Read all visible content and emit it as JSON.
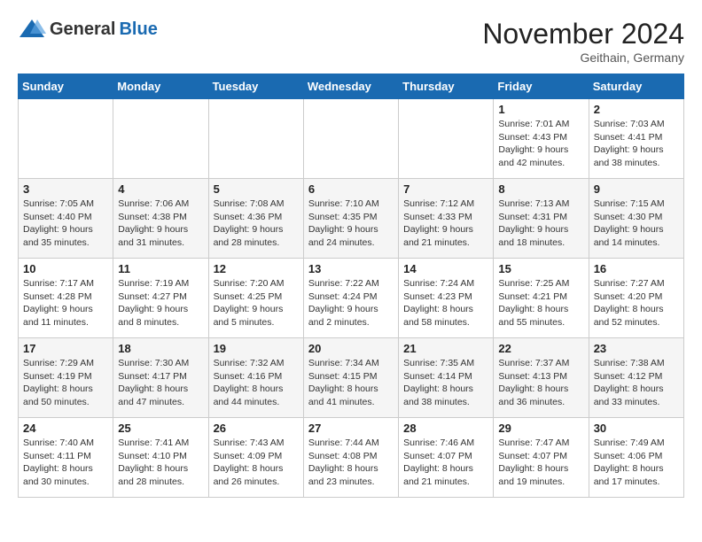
{
  "header": {
    "logo_general": "General",
    "logo_blue": "Blue",
    "month_title": "November 2024",
    "location": "Geithain, Germany"
  },
  "days_of_week": [
    "Sunday",
    "Monday",
    "Tuesday",
    "Wednesday",
    "Thursday",
    "Friday",
    "Saturday"
  ],
  "weeks": [
    [
      {
        "day": "",
        "info": ""
      },
      {
        "day": "",
        "info": ""
      },
      {
        "day": "",
        "info": ""
      },
      {
        "day": "",
        "info": ""
      },
      {
        "day": "",
        "info": ""
      },
      {
        "day": "1",
        "info": "Sunrise: 7:01 AM\nSunset: 4:43 PM\nDaylight: 9 hours\nand 42 minutes."
      },
      {
        "day": "2",
        "info": "Sunrise: 7:03 AM\nSunset: 4:41 PM\nDaylight: 9 hours\nand 38 minutes."
      }
    ],
    [
      {
        "day": "3",
        "info": "Sunrise: 7:05 AM\nSunset: 4:40 PM\nDaylight: 9 hours\nand 35 minutes."
      },
      {
        "day": "4",
        "info": "Sunrise: 7:06 AM\nSunset: 4:38 PM\nDaylight: 9 hours\nand 31 minutes."
      },
      {
        "day": "5",
        "info": "Sunrise: 7:08 AM\nSunset: 4:36 PM\nDaylight: 9 hours\nand 28 minutes."
      },
      {
        "day": "6",
        "info": "Sunrise: 7:10 AM\nSunset: 4:35 PM\nDaylight: 9 hours\nand 24 minutes."
      },
      {
        "day": "7",
        "info": "Sunrise: 7:12 AM\nSunset: 4:33 PM\nDaylight: 9 hours\nand 21 minutes."
      },
      {
        "day": "8",
        "info": "Sunrise: 7:13 AM\nSunset: 4:31 PM\nDaylight: 9 hours\nand 18 minutes."
      },
      {
        "day": "9",
        "info": "Sunrise: 7:15 AM\nSunset: 4:30 PM\nDaylight: 9 hours\nand 14 minutes."
      }
    ],
    [
      {
        "day": "10",
        "info": "Sunrise: 7:17 AM\nSunset: 4:28 PM\nDaylight: 9 hours\nand 11 minutes."
      },
      {
        "day": "11",
        "info": "Sunrise: 7:19 AM\nSunset: 4:27 PM\nDaylight: 9 hours\nand 8 minutes."
      },
      {
        "day": "12",
        "info": "Sunrise: 7:20 AM\nSunset: 4:25 PM\nDaylight: 9 hours\nand 5 minutes."
      },
      {
        "day": "13",
        "info": "Sunrise: 7:22 AM\nSunset: 4:24 PM\nDaylight: 9 hours\nand 2 minutes."
      },
      {
        "day": "14",
        "info": "Sunrise: 7:24 AM\nSunset: 4:23 PM\nDaylight: 8 hours\nand 58 minutes."
      },
      {
        "day": "15",
        "info": "Sunrise: 7:25 AM\nSunset: 4:21 PM\nDaylight: 8 hours\nand 55 minutes."
      },
      {
        "day": "16",
        "info": "Sunrise: 7:27 AM\nSunset: 4:20 PM\nDaylight: 8 hours\nand 52 minutes."
      }
    ],
    [
      {
        "day": "17",
        "info": "Sunrise: 7:29 AM\nSunset: 4:19 PM\nDaylight: 8 hours\nand 50 minutes."
      },
      {
        "day": "18",
        "info": "Sunrise: 7:30 AM\nSunset: 4:17 PM\nDaylight: 8 hours\nand 47 minutes."
      },
      {
        "day": "19",
        "info": "Sunrise: 7:32 AM\nSunset: 4:16 PM\nDaylight: 8 hours\nand 44 minutes."
      },
      {
        "day": "20",
        "info": "Sunrise: 7:34 AM\nSunset: 4:15 PM\nDaylight: 8 hours\nand 41 minutes."
      },
      {
        "day": "21",
        "info": "Sunrise: 7:35 AM\nSunset: 4:14 PM\nDaylight: 8 hours\nand 38 minutes."
      },
      {
        "day": "22",
        "info": "Sunrise: 7:37 AM\nSunset: 4:13 PM\nDaylight: 8 hours\nand 36 minutes."
      },
      {
        "day": "23",
        "info": "Sunrise: 7:38 AM\nSunset: 4:12 PM\nDaylight: 8 hours\nand 33 minutes."
      }
    ],
    [
      {
        "day": "24",
        "info": "Sunrise: 7:40 AM\nSunset: 4:11 PM\nDaylight: 8 hours\nand 30 minutes."
      },
      {
        "day": "25",
        "info": "Sunrise: 7:41 AM\nSunset: 4:10 PM\nDaylight: 8 hours\nand 28 minutes."
      },
      {
        "day": "26",
        "info": "Sunrise: 7:43 AM\nSunset: 4:09 PM\nDaylight: 8 hours\nand 26 minutes."
      },
      {
        "day": "27",
        "info": "Sunrise: 7:44 AM\nSunset: 4:08 PM\nDaylight: 8 hours\nand 23 minutes."
      },
      {
        "day": "28",
        "info": "Sunrise: 7:46 AM\nSunset: 4:07 PM\nDaylight: 8 hours\nand 21 minutes."
      },
      {
        "day": "29",
        "info": "Sunrise: 7:47 AM\nSunset: 4:07 PM\nDaylight: 8 hours\nand 19 minutes."
      },
      {
        "day": "30",
        "info": "Sunrise: 7:49 AM\nSunset: 4:06 PM\nDaylight: 8 hours\nand 17 minutes."
      }
    ]
  ]
}
